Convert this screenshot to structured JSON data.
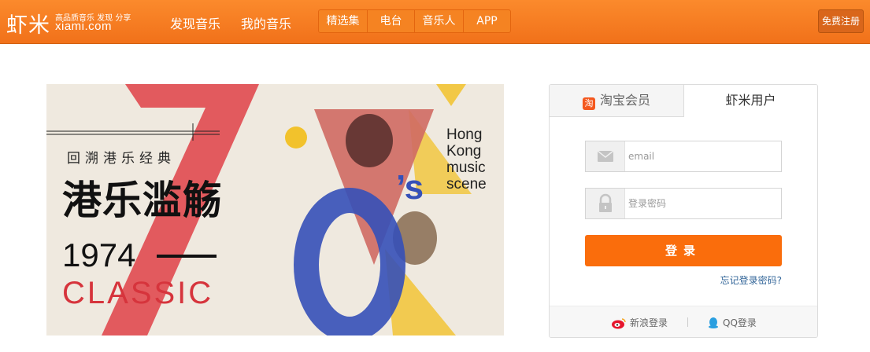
{
  "header": {
    "logo_cn": "虾米",
    "logo_tagline": "高品质音乐 发现 分享",
    "logo_en": "xiami.com",
    "nav": [
      "发现音乐",
      "我的音乐"
    ],
    "subnav": [
      "精选集",
      "电台",
      "音乐人",
      "APP"
    ],
    "register_label": "免费注册"
  },
  "banner": {
    "subtitle": "回溯港乐经典",
    "title": "港乐滥觞",
    "year": "1974",
    "classic": "CLASSIC",
    "tagline": [
      "Hong",
      "Kong",
      "music",
      "scene"
    ],
    "colors": {
      "red": "#e0454c",
      "blue": "#3550b8",
      "yellow": "#f2c22c"
    }
  },
  "login": {
    "tabs": {
      "taobao": "淘宝会员",
      "taobao_icon": "淘",
      "xiami": "虾米用户"
    },
    "email_placeholder": "email",
    "password_placeholder": "登录密码",
    "submit_label": "登录",
    "forgot_label": "忘记登录密码?",
    "social": {
      "weibo": "新浪登录",
      "qq": "QQ登录"
    },
    "accent": "#fa6d0c"
  }
}
